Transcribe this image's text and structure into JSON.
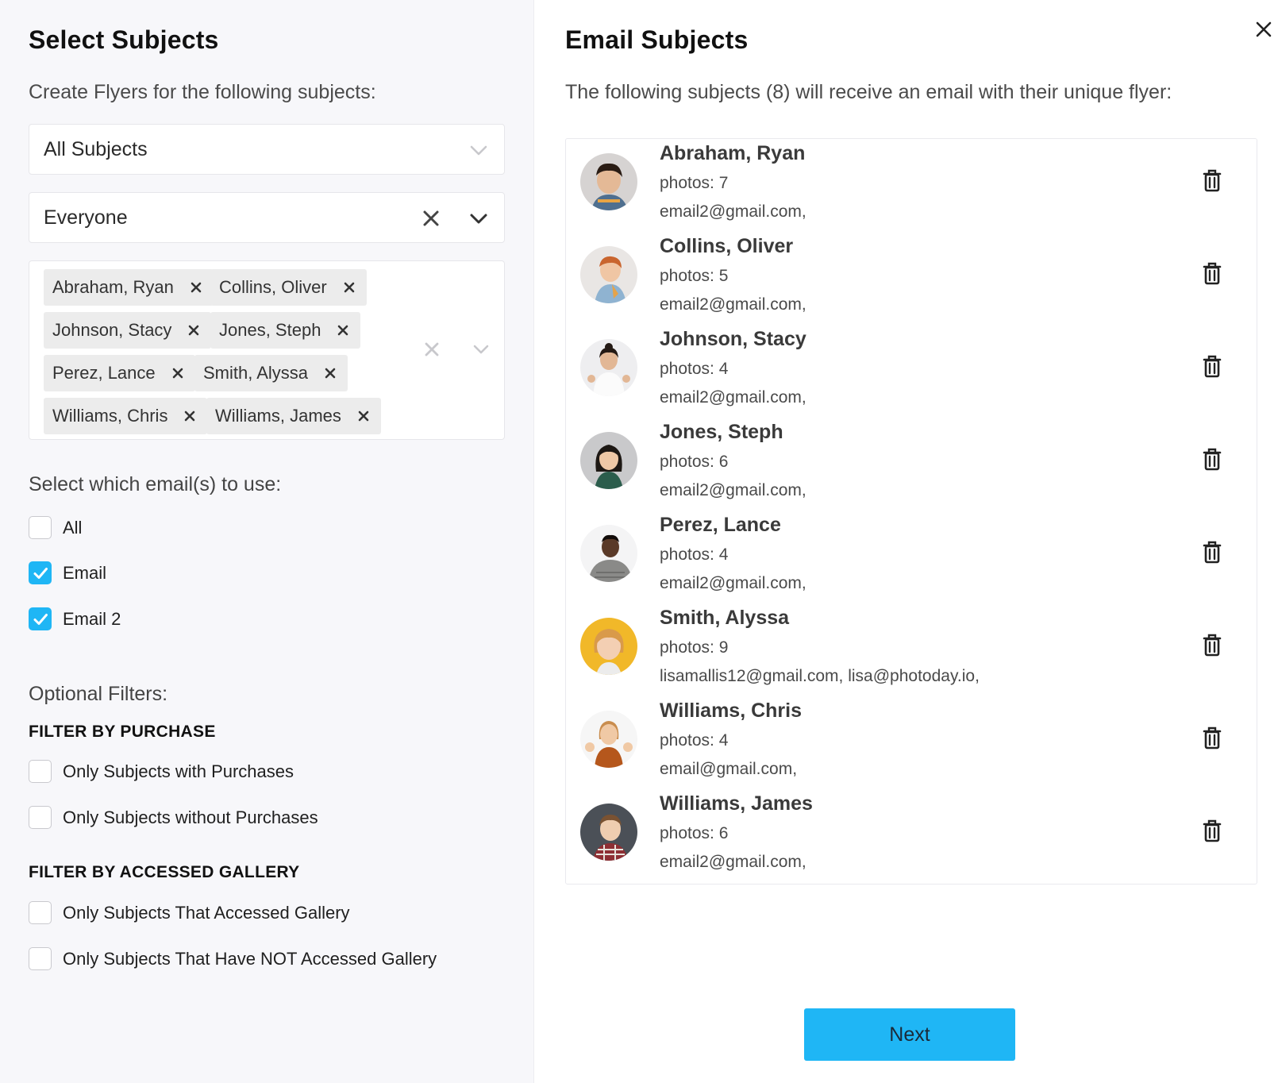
{
  "left": {
    "title": "Select Subjects",
    "subtitle": "Create Flyers for the following subjects:",
    "subjects_select": {
      "value": "All Subjects"
    },
    "group_select": {
      "value": "Everyone"
    },
    "selected_tags": [
      "Abraham, Ryan",
      "Collins, Oliver",
      "Johnson, Stacy",
      "Jones, Steph",
      "Perez, Lance",
      "Smith, Alyssa",
      "Williams, Chris",
      "Williams, James"
    ],
    "email_section": {
      "label": "Select which email(s) to use:",
      "options": [
        {
          "label": "All",
          "checked": false
        },
        {
          "label": "Email",
          "checked": true
        },
        {
          "label": "Email 2",
          "checked": true
        }
      ]
    },
    "optional_filters": {
      "label": "Optional Filters:",
      "purchase_heading": "FILTER BY PURCHASE",
      "purchase_options": [
        {
          "label": "Only Subjects with Purchases",
          "checked": false
        },
        {
          "label": "Only Subjects without Purchases",
          "checked": false
        }
      ],
      "gallery_heading": "FILTER BY ACCESSED GALLERY",
      "gallery_options": [
        {
          "label": "Only Subjects That Accessed Gallery",
          "checked": false
        },
        {
          "label": "Only Subjects That Have NOT Accessed Gallery",
          "checked": false
        }
      ]
    }
  },
  "right": {
    "title": "Email Subjects",
    "subtitle": "The following subjects (8) will receive an email with their unique flyer:",
    "subjects": [
      {
        "name": "Abraham, Ryan",
        "photos": "photos: 7",
        "emails": "email2@gmail.com,"
      },
      {
        "name": "Collins, Oliver",
        "photos": "photos: 5",
        "emails": "email2@gmail.com,"
      },
      {
        "name": "Johnson, Stacy",
        "photos": "photos: 4",
        "emails": "email2@gmail.com,"
      },
      {
        "name": "Jones, Steph",
        "photos": "photos: 6",
        "emails": "email2@gmail.com,"
      },
      {
        "name": "Perez, Lance",
        "photos": "photos: 4",
        "emails": "email2@gmail.com,"
      },
      {
        "name": "Smith, Alyssa",
        "photos": "photos: 9",
        "emails": "lisamallis12@gmail.com, lisa@photoday.io,"
      },
      {
        "name": "Williams, Chris",
        "photos": "photos: 4",
        "emails": "email@gmail.com,"
      },
      {
        "name": "Williams, James",
        "photos": "photos: 6",
        "emails": "email2@gmail.com,"
      }
    ],
    "next_label": "Next"
  },
  "colors": {
    "accent": "#1fb6f5",
    "tag_bg": "#ececec",
    "panel_bg": "#f7f7fa"
  },
  "icons": [
    "chevron-down-icon",
    "close-icon",
    "check-icon",
    "trash-icon"
  ]
}
